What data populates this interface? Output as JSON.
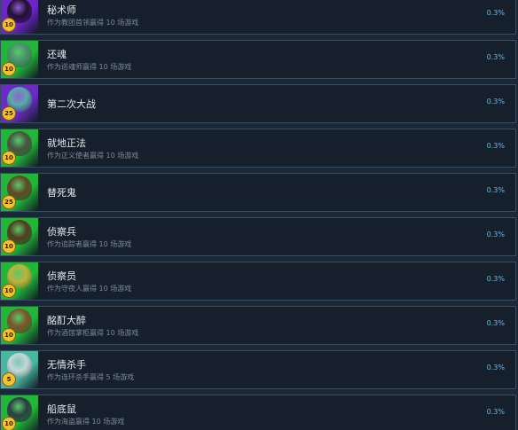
{
  "achievements": [
    {
      "title": "秘术师",
      "subtitle": "作为教团首领赢得 10 场游戏",
      "percent": "0.3%",
      "badge": "10",
      "icon": "mystic-icon",
      "bg": "#6d24c8",
      "art": "#1b1022"
    },
    {
      "title": "还魂",
      "subtitle": "作为巡魂师赢得 10 场游戏",
      "percent": "0.3%",
      "badge": "10",
      "icon": "ghost-icon",
      "bg": "#21b63a",
      "art": "#4f8c74"
    },
    {
      "title": "第二次大战",
      "subtitle": "",
      "percent": "0.3%",
      "badge": "25",
      "icon": "skull-icon",
      "bg": "#6a2cc4",
      "art": "#55bba4"
    },
    {
      "title": "就地正法",
      "subtitle": "作为正义使者赢得 10 场游戏",
      "percent": "0.3%",
      "badge": "10",
      "icon": "hooded-figure-icon",
      "bg": "#21b63a",
      "art": "#4d4944"
    },
    {
      "title": "替死鬼",
      "subtitle": "",
      "percent": "0.3%",
      "badge": "25",
      "icon": "shield-icon",
      "bg": "#21b63a",
      "art": "#6b3a24"
    },
    {
      "title": "侦察兵",
      "subtitle": "作为追踪者赢得 10 场游戏",
      "percent": "0.3%",
      "badge": "10",
      "icon": "tracker-icon",
      "bg": "#21b63a",
      "art": "#5b2d1f"
    },
    {
      "title": "侦察员",
      "subtitle": "作为守夜人赢得 10 场游戏",
      "percent": "0.3%",
      "badge": "10",
      "icon": "spyglass-icon",
      "bg": "#21b63a",
      "art": "#d3b13a"
    },
    {
      "title": "酩酊大醉",
      "subtitle": "作为酒馆掌柜赢得 10 场游戏",
      "percent": "0.3%",
      "badge": "10",
      "icon": "bottle-icon",
      "bg": "#21b63a",
      "art": "#874a2a"
    },
    {
      "title": "无情杀手",
      "subtitle": "作为连环杀手赢得 5 场游戏",
      "percent": "0.3%",
      "badge": "5",
      "icon": "knife-icon",
      "bg": "#48b7a1",
      "art": "#d7d9dd"
    },
    {
      "title": "船底鼠",
      "subtitle": "作为海盗赢得 10 场游戏",
      "percent": "0.3%",
      "badge": "10",
      "icon": "pirate-flag-icon",
      "bg": "#21b63a",
      "art": "#2f3142"
    }
  ]
}
